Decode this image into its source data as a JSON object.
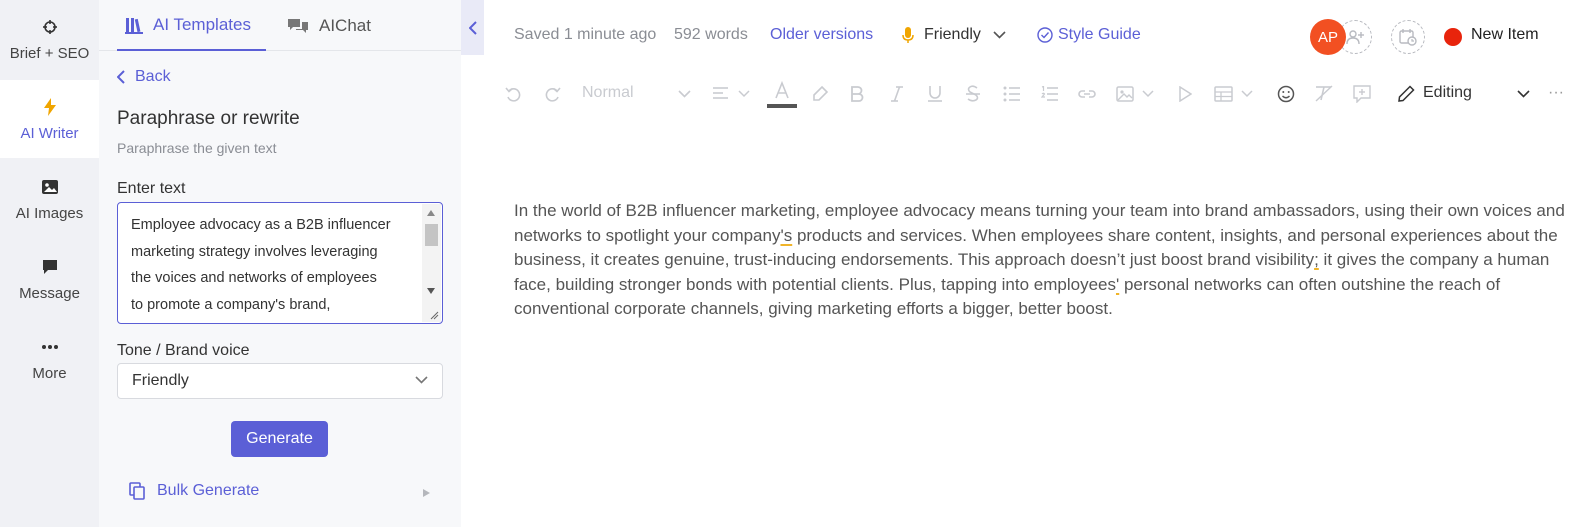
{
  "rail": {
    "items": [
      {
        "label": "Brief + SEO",
        "icon": "crosshair-icon"
      },
      {
        "label": "AI Writer",
        "icon": "lightning-icon"
      },
      {
        "label": "AI Images",
        "icon": "image-icon"
      },
      {
        "label": "Message",
        "icon": "chat-bubble-icon"
      },
      {
        "label": "More",
        "icon": "ellipsis-icon"
      }
    ],
    "active_index": 1
  },
  "panel": {
    "tabs": [
      {
        "label": "AI Templates",
        "icon": "library-icon"
      },
      {
        "label": "AIChat",
        "icon": "chat-icon"
      }
    ],
    "back_label": "Back",
    "title": "Paraphrase or rewrite",
    "subtitle": "Paraphrase the given text",
    "enter_text_label": "Enter text",
    "input_lines": [
      "Employee advocacy as a B2B influencer",
      "marketing strategy involves leveraging",
      "the voices and networks of employees",
      "to promote a company's brand,"
    ],
    "tone_label": "Tone / Brand voice",
    "tone_value": "Friendly",
    "generate_label": "Generate",
    "bulk_label": "Bulk Generate"
  },
  "topbar": {
    "saved": "Saved 1 minute ago",
    "words": "592 words",
    "older_versions": "Older versions",
    "tone": "Friendly",
    "style_guide": "Style Guide",
    "avatar_initials": "AP",
    "new_item": "New Item"
  },
  "toolbar": {
    "paragraph_style": "Normal",
    "editing": "Editing",
    "more": "···"
  },
  "document": {
    "paragraph_parts": [
      "In the world of B2B influencer marketing, employee advocacy means turning your team into brand ambassadors, using their own voices and networks to spotlight your company",
      "'s",
      " products and services. When employees share content, insights, and personal experiences about the business, it creates genuine, trust-inducing endorsements. This approach doesn’t just boost brand visibility",
      ";",
      " it gives the company a human face, building stronger bonds with potential clients. Plus, tapping into employees",
      "'",
      " personal networks can often outshine the reach of conventional corporate channels, giving marketing efforts a bigger, better boost."
    ]
  },
  "colors": {
    "accent": "#5b5fd6",
    "avatar": "#f25022",
    "status_dot": "#e8240c",
    "highlight_underline": "#f0b429"
  }
}
